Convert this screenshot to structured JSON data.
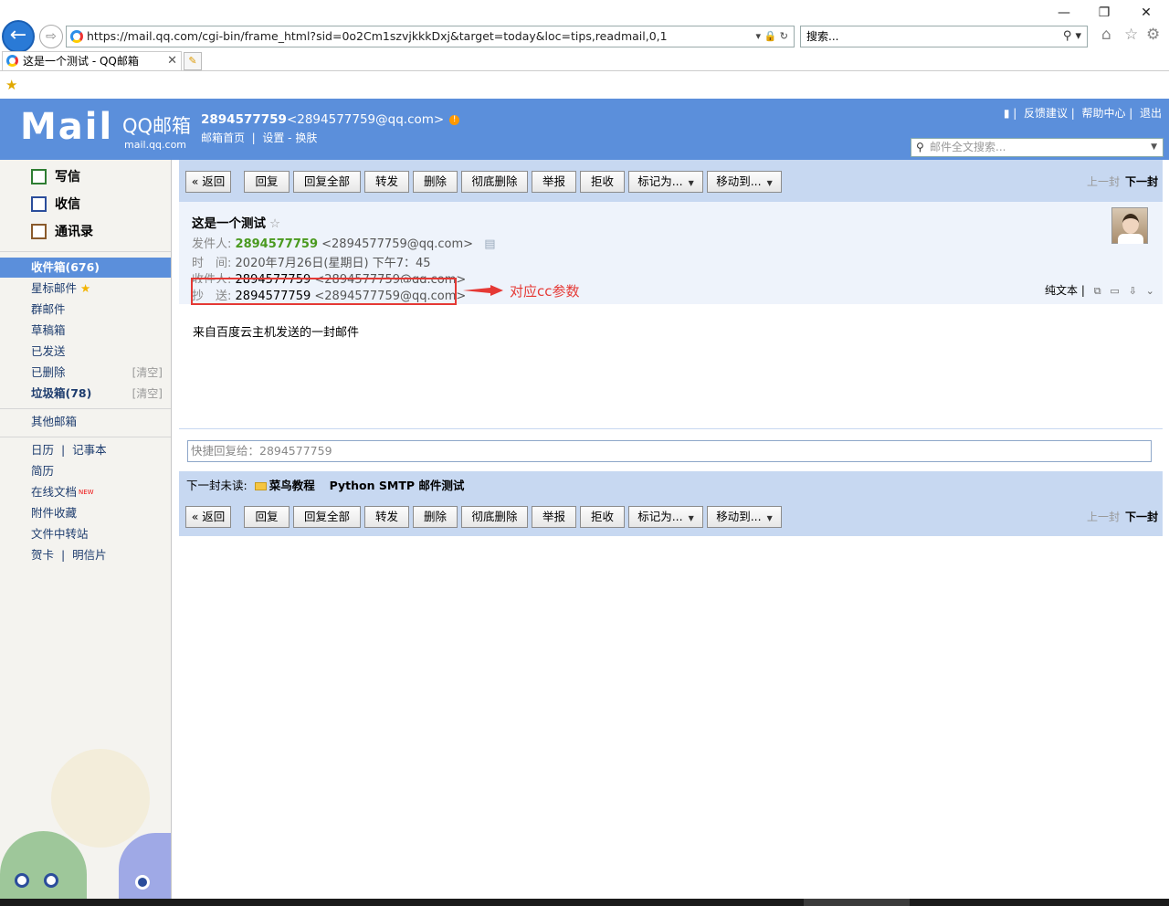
{
  "browser": {
    "url": "https://mail.qq.com/cgi-bin/frame_html?sid=0o2Cm1szvjkkkDxj&target=today&loc=tips,readmail,0,1",
    "search_placeholder": "搜索...",
    "tab_title": "这是一个测试 - QQ邮箱"
  },
  "header": {
    "logo_text": "Mail",
    "logo_brand": "QQ邮箱",
    "logo_domain": "mail.qq.com",
    "account_id": "2894577759",
    "account_email": "<2894577759@qq.com>",
    "nav_home": "邮箱首页",
    "nav_settings": "设置",
    "nav_sep": "-",
    "nav_skin": "换肤",
    "link_feedback": "反馈建议",
    "link_help": "帮助中心",
    "link_logout": "退出",
    "fulltext_search": "邮件全文搜索..."
  },
  "sidebar": {
    "compose": "写信",
    "inbox_action": "收信",
    "contacts": "通讯录",
    "folders": [
      {
        "label": "收件箱(676)"
      },
      {
        "label": "星标邮件"
      },
      {
        "label": "群邮件"
      },
      {
        "label": "草稿箱"
      },
      {
        "label": "已发送"
      },
      {
        "label": "已删除",
        "clear": "[清空]"
      },
      {
        "label": "垃圾箱(78)",
        "clear": "[清空]"
      }
    ],
    "other_mailbox": "其他邮箱",
    "calendar": "日历",
    "notes": "记事本",
    "resume": "简历",
    "online_docs": "在线文档",
    "new_tag": "NEW",
    "attach_fav": "附件收藏",
    "file_transfer": "文件中转站",
    "cards": "贺卡",
    "postcard": "明信片"
  },
  "toolbar": {
    "back": "« 返回",
    "reply": "回复",
    "reply_all": "回复全部",
    "forward": "转发",
    "delete": "删除",
    "delete_perm": "彻底删除",
    "report": "举报",
    "reject": "拒收",
    "mark_as": "标记为...",
    "move_to": "移动到...",
    "prev": "上一封",
    "next": "下一封"
  },
  "mail": {
    "subject": "这是一个测试",
    "from_label": "发件人:",
    "from_name": "2894577759",
    "from_addr": "<2894577759@qq.com>",
    "time_label": "时　间:",
    "time_value": "2020年7月26日(星期日) 下午7：45",
    "to_label": "收件人:",
    "to_name": "2894577759",
    "to_addr": "<2894577759@qq.com>",
    "cc_label": "抄　送:",
    "cc_name": "2894577759",
    "cc_addr": "<2894577759@qq.com>",
    "plain_text": "纯文本",
    "body": "来自百度云主机发送的一封邮件",
    "annotation": "对应cc参数"
  },
  "quick_reply": {
    "placeholder": "快捷回复给：2894577759"
  },
  "next_unread": {
    "label": "下一封未读:",
    "sender": "菜鸟教程",
    "subject": "Python SMTP 邮件测试"
  },
  "colors": {
    "header_bg": "#5b8fdb",
    "toolbar_bg": "#c7d8f1",
    "annotation": "#e53935",
    "sender_green": "#4a9a1f"
  }
}
